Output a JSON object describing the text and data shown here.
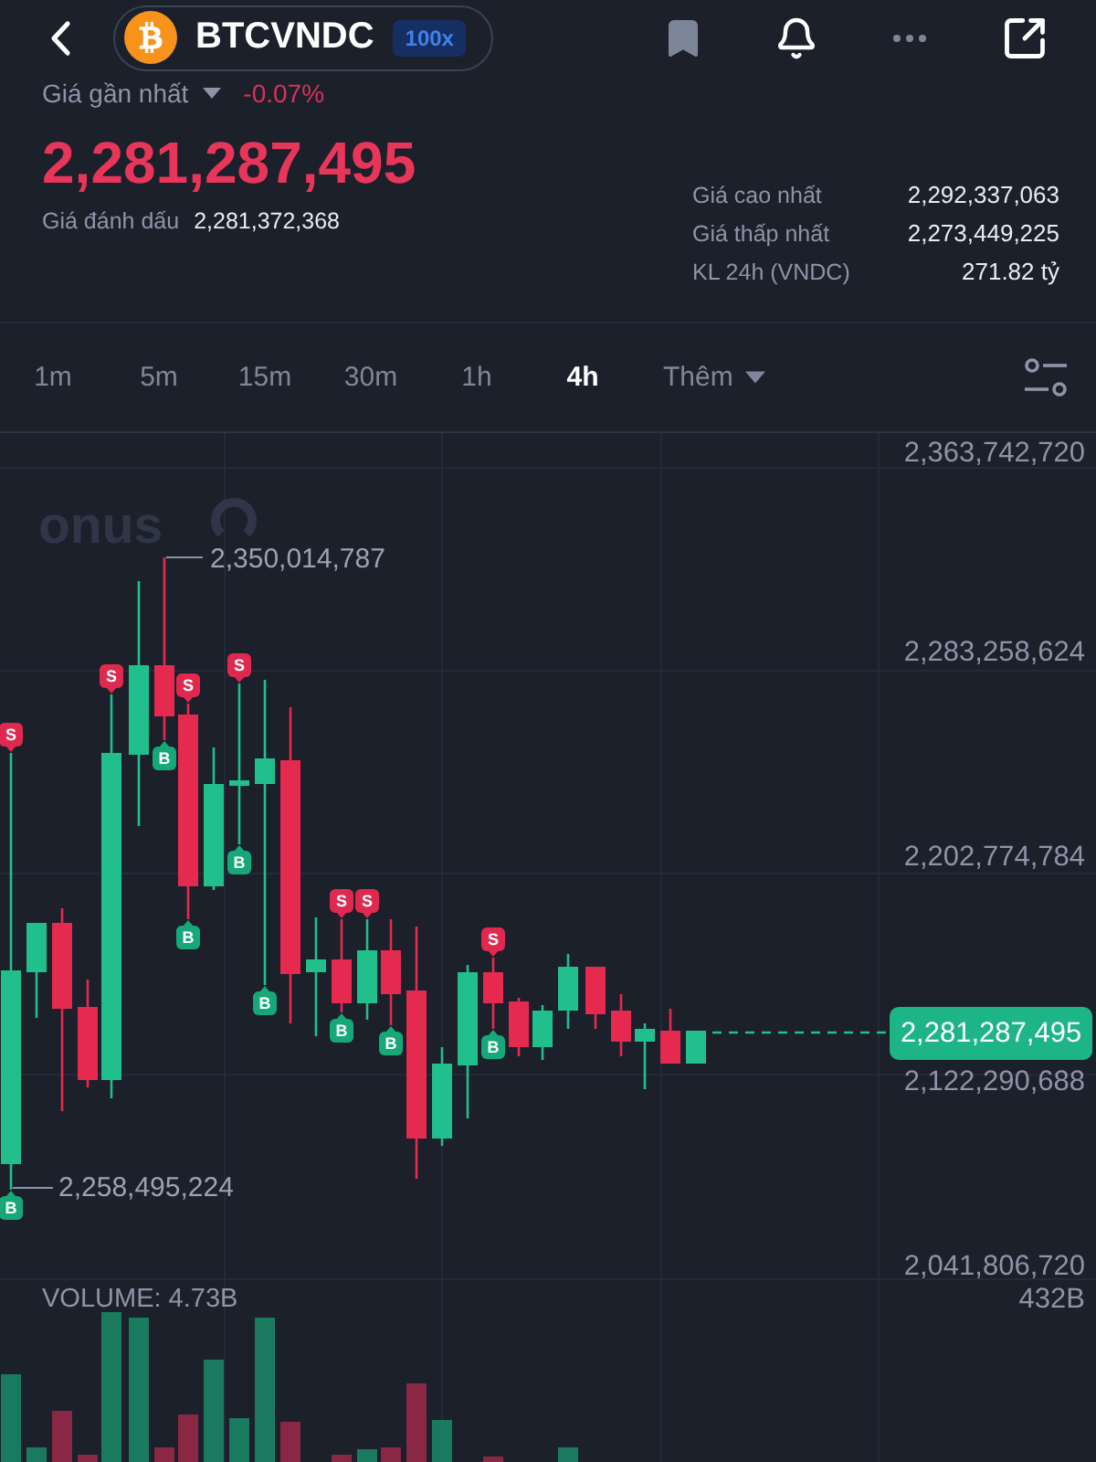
{
  "header": {
    "pair": "BTCVNDC",
    "leverage": "100x"
  },
  "price_summary": {
    "last_price_label": "Giá gần nhất",
    "change": "-0.07%",
    "last_price": "2,281,287,495",
    "mark_price_label": "Giá đánh dấu",
    "mark_price": "2,281,372,368",
    "stats": [
      {
        "label": "Giá cao nhất",
        "value": "2,292,337,063"
      },
      {
        "label": "Giá thấp nhất",
        "value": "2,273,449,225"
      },
      {
        "label": "KL 24h (VNDC)",
        "value": "271.82 tỷ"
      }
    ]
  },
  "timeframes": [
    {
      "label": "1m",
      "selected": false
    },
    {
      "label": "5m",
      "selected": false
    },
    {
      "label": "15m",
      "selected": false
    },
    {
      "label": "30m",
      "selected": false
    },
    {
      "label": "1h",
      "selected": false
    },
    {
      "label": "4h",
      "selected": true
    }
  ],
  "more_timeframes": {
    "label": "Thêm"
  },
  "chart": {
    "watermark": "onus",
    "price_axis": [
      "2,363,742,720",
      "2,283,258,624",
      "2,202,774,784",
      "2,122,290,688",
      "2,041,806,720"
    ],
    "high_label": "2,350,014,787",
    "low_label": "2,258,495,224",
    "price_tag": "2,281,287,495",
    "markers": [
      {
        "kind": "sell",
        "label": "S"
      },
      {
        "kind": "buy",
        "label": "B"
      },
      {
        "kind": "sell",
        "label": "S"
      },
      {
        "kind": "buy",
        "label": "B"
      },
      {
        "kind": "sell",
        "label": "S"
      },
      {
        "kind": "buy",
        "label": "B"
      },
      {
        "kind": "sell",
        "label": "S"
      },
      {
        "kind": "buy",
        "label": "B"
      },
      {
        "kind": "buy",
        "label": "B"
      },
      {
        "kind": "sell",
        "label": "S"
      },
      {
        "kind": "buy",
        "label": "B"
      },
      {
        "kind": "sell",
        "label": "S"
      },
      {
        "kind": "buy",
        "label": "B"
      },
      {
        "kind": "sell",
        "label": "S"
      },
      {
        "kind": "buy",
        "label": "B"
      }
    ],
    "volume_label": "VOLUME: 4.73B",
    "volume_axis": "432B"
  }
}
